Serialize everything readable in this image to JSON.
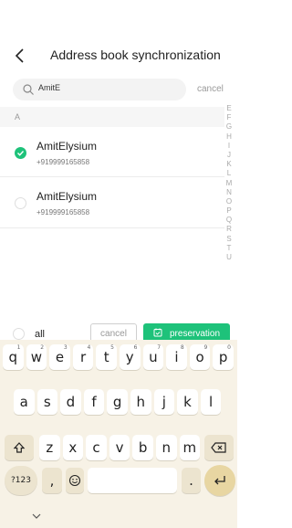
{
  "header": {
    "title": "Address book synchronization"
  },
  "search": {
    "value": "AmitE",
    "cancel_label": "cancel"
  },
  "section": {
    "letter": "A"
  },
  "contacts": [
    {
      "name": "AmitElysium",
      "phone": "+919999165858",
      "selected": true
    },
    {
      "name": "AmitElysium",
      "phone": "+919999165858",
      "selected": false
    }
  ],
  "alpha_index": [
    "E",
    "F",
    "G",
    "H",
    "I",
    "J",
    "K",
    "L",
    "M",
    "N",
    "O",
    "P",
    "Q",
    "R",
    "S",
    "T",
    "U"
  ],
  "actions": {
    "all_label": "all",
    "cancel_label": "cancel",
    "save_label": "preservation"
  },
  "keyboard": {
    "row1": [
      {
        "k": "q",
        "h": "1"
      },
      {
        "k": "w",
        "h": "2"
      },
      {
        "k": "e",
        "h": "3"
      },
      {
        "k": "r",
        "h": "4"
      },
      {
        "k": "t",
        "h": "5"
      },
      {
        "k": "y",
        "h": "6"
      },
      {
        "k": "u",
        "h": "7"
      },
      {
        "k": "i",
        "h": "8"
      },
      {
        "k": "o",
        "h": "9"
      },
      {
        "k": "p",
        "h": "0"
      }
    ],
    "row2": [
      "a",
      "s",
      "d",
      "f",
      "g",
      "h",
      "j",
      "k",
      "l"
    ],
    "row3": [
      "z",
      "x",
      "c",
      "v",
      "b",
      "n",
      "m"
    ],
    "sym_label": "?123",
    "comma": ",",
    "period": "."
  },
  "colors": {
    "accent": "#1ec27a",
    "keyboard_bg": "#f7f2e6",
    "enter_key": "#e8d6a2"
  }
}
